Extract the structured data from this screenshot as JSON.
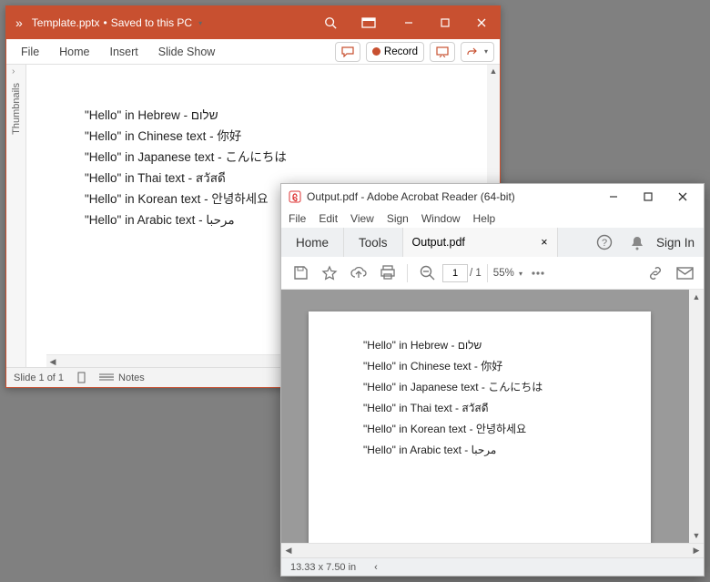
{
  "powerpoint": {
    "title_file": "Template.pptx",
    "title_state": "Saved to this PC",
    "title_sep": " • ",
    "tabs": {
      "file": "File",
      "home": "Home",
      "insert": "Insert",
      "slideshow": "Slide Show"
    },
    "record_label": "Record",
    "thumbnails_label": "Thumbnails",
    "slide_lines": [
      "\"Hello\" in Hebrew - שלום",
      "\"Hello\" in Chinese text - 你好",
      "\"Hello\" in Japanese text - こんにちは",
      "\"Hello\" in Thai text - สวัสดี",
      "\"Hello\" in Korean text - 안녕하세요",
      "\"Hello\" in Arabic text - مرحبا"
    ],
    "status": {
      "slide": "Slide 1 of 1",
      "notes": "Notes"
    }
  },
  "acrobat": {
    "title": "Output.pdf - Adobe Acrobat Reader (64-bit)",
    "menus": {
      "file": "File",
      "edit": "Edit",
      "view": "View",
      "sign": "Sign",
      "window": "Window",
      "help": "Help"
    },
    "nav": {
      "home": "Home",
      "tools": "Tools"
    },
    "doc_tab": "Output.pdf",
    "signin": "Sign In",
    "toolbar": {
      "page_current": "1",
      "page_total": "/  1",
      "zoom": "55%"
    },
    "page_lines": [
      "\"Hello\" in Hebrew - שלום",
      "\"Hello\" in Chinese text - 你好",
      "\"Hello\" in Japanese text - こんにちは",
      "\"Hello\" in Thai text - สวัสดี",
      "\"Hello\" in Korean text - 안녕하세요",
      "\"Hello\" in Arabic text - مرحبا"
    ],
    "status": {
      "dims": "13.33 x 7.50 in"
    }
  }
}
